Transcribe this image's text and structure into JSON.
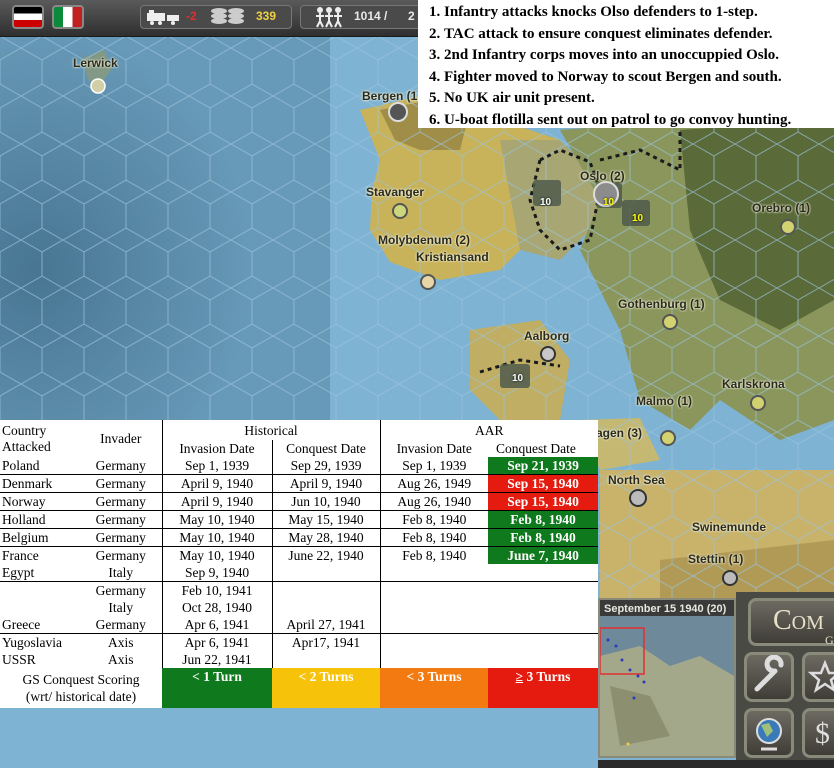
{
  "top_bar": {
    "flag_1": "germany-flag-icon",
    "flag_2": "italy-flag-icon",
    "production_delta": "-2",
    "mpp_value": "339",
    "manpower_value": "1014 /",
    "manpower_cut": "2"
  },
  "events": [
    "Infantry attacks knocks Olso defenders to 1-step.",
    "TAC attack to ensure conquest eliminates defender.",
    "2nd Infantry corps moves into an unoccuppied Oslo.",
    "Fighter moved to Norway to scout Bergen and south.",
    "No UK air unit present.",
    "U-boat flotilla sent out on patrol to go convoy hunting."
  ],
  "map_labels": {
    "lerwick": "Lerwick",
    "bergen": "Bergen (1)",
    "stavanger": "Stavanger",
    "oslo": "Oslo (2)",
    "orebro": "Orebro (1)",
    "molybdenum": "Molybdenum (2)",
    "kristiansand": "Kristiansand",
    "gothenburg": "Gothenburg (1)",
    "aalborg": "Aalborg",
    "karlskrona": "Karlskrona",
    "malmo": "Malmo (1)",
    "north_sea": "North Sea",
    "copenhagen_cut": "agen (3)",
    "swinemunde": "Swinemunde",
    "stettin": "Stettin (1)"
  },
  "unit_strengths": [
    "10",
    "10",
    "10",
    "10"
  ],
  "table": {
    "headers": {
      "country": "Country Attacked",
      "invader": "Invader",
      "historical": "Historical",
      "aar": "AAR",
      "hist_invasion": "Invasion Date",
      "hist_conquest": "Conquest Date",
      "aar_invasion": "Invasion Date",
      "aar_conquest": "Conquest Date"
    },
    "rows": [
      {
        "country": "Poland",
        "invader": "Germany",
        "hist_inv": "Sep 1, 1939",
        "hist_conq": "Sep 29, 1939",
        "aar_inv": "Sep 1, 1939",
        "aar_conq": "Sep 21, 1939"
      },
      {
        "country": "Denmark",
        "invader": "Germany",
        "hist_inv": "April 9, 1940",
        "hist_conq": "April 9, 1940",
        "aar_inv": "Aug 26, 1949",
        "aar_conq": "Sep 15, 1940"
      },
      {
        "country": "Norway",
        "invader": "Germany",
        "hist_inv": "April 9, 1940",
        "hist_conq": "Jun 10, 1940",
        "aar_inv": "Aug 26, 1940",
        "aar_conq": "Sep 15, 1940"
      },
      {
        "country": "Holland",
        "invader": "Germany",
        "hist_inv": "May 10, 1940",
        "hist_conq": "May 15, 1940",
        "aar_inv": "Feb 8, 1940",
        "aar_conq": "Feb 8, 1940"
      },
      {
        "country": "Belgium",
        "invader": "Germany",
        "hist_inv": "May 10, 1940",
        "hist_conq": "May 28, 1940",
        "aar_inv": "Feb 8, 1940",
        "aar_conq": "Feb 8, 1940"
      },
      {
        "country": "France",
        "invader": "Germany",
        "hist_inv": "May 10, 1940",
        "hist_conq": "June 22, 1940",
        "aar_inv": "Feb 8, 1940",
        "aar_conq": "June 7, 1940"
      },
      {
        "country": "Egypt",
        "invader": "Italy",
        "hist_inv": "Sep 9, 1940"
      },
      {
        "invader": "Germany",
        "hist_inv": "Feb 10, 1941"
      },
      {
        "invader": "Italy",
        "hist_inv": "Oct 28, 1940"
      },
      {
        "country": "Greece",
        "invader": "Germany",
        "hist_inv": "Apr 6, 1941",
        "hist_conq": "April 27, 1941"
      },
      {
        "country": "Yugoslavia",
        "invader": "Axis",
        "hist_inv": "Apr 6, 1941",
        "hist_conq": "Apr17, 1941"
      },
      {
        "country": "USSR",
        "invader": "Axis",
        "hist_inv": "Jun 22, 1941"
      }
    ],
    "scoring": {
      "label_1": "GS Conquest Scoring",
      "label_2": "(wrt/ historical date)",
      "green": "< 1 Turn",
      "yellow": "< 2 Turns",
      "orange": "< 3 Turns",
      "red_symbol": "≥",
      "red_rest": " 3 Turns"
    }
  },
  "minimap": {
    "title": "September 15 1940 (20)"
  },
  "menu": {
    "title_partial": "Com",
    "subtitle_partial": "G"
  },
  "colors": {
    "green": "#0f7a1d",
    "red": "#e41b0e",
    "yellow": "#f7c20a",
    "orange": "#f27a10"
  }
}
